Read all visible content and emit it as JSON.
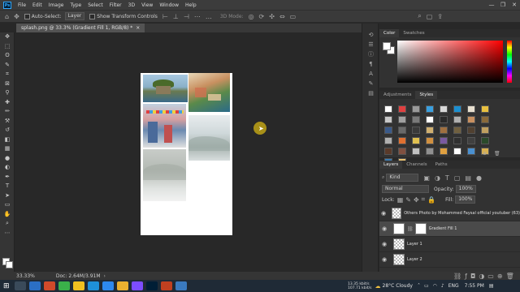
{
  "menubar": {
    "logo": "Ps",
    "items": [
      "File",
      "Edit",
      "Image",
      "Type",
      "Select",
      "Filter",
      "3D",
      "View",
      "Window",
      "Help"
    ],
    "window_controls": [
      "—",
      "❐",
      "✕"
    ]
  },
  "options": {
    "auto_select_label": "Auto-Select:",
    "auto_select_value": "Layer",
    "show_transform_label": "Show Transform Controls",
    "mode_3d": "3D Mode:"
  },
  "document": {
    "tab_title": "splash.png @ 33.3% (Gradient Fill 1, RGB/8) *",
    "tab_close": "×"
  },
  "color_panel": {
    "tabs": [
      "Color",
      "Swatches"
    ],
    "foreground": "#ffffff",
    "background": "#ffffff",
    "hue": "#ff0000"
  },
  "styles_panel": {
    "tabs": [
      "Adjustments",
      "Styles"
    ],
    "swatch_colors": [
      "#ffffff",
      "#e04040",
      "#9a9a9a",
      "#3aa0e0",
      "#d8d8d8",
      "#1c8fd0",
      "#e8e0d0",
      "#e8c040",
      "#c8c8c8",
      "#a0a0a0",
      "#7a7a7a",
      "#ffffff",
      "#2a2a2a",
      "#b0b0b0",
      "#c89060",
      "#8a6a3a",
      "#3a5a8a",
      "#6a6a6a",
      "#3a3a3a",
      "#d0b070",
      "#a07040",
      "#706040",
      "#504030",
      "#c0a060",
      "#b0b0b0",
      "#e07030",
      "#e0c050",
      "#d09040",
      "#7a5aa0",
      "#303030",
      "#404040",
      "#2a4a2a",
      "#5a3a2a",
      "#805040",
      "#c0c0c0",
      "#909090",
      "#e0a040",
      "#ffffff",
      "#4a90d0",
      "#d8b050",
      "#3a7ab0",
      "#e8c070"
    ]
  },
  "layers_panel": {
    "tabs": [
      "Layers",
      "Channels",
      "Paths"
    ],
    "filter_kind": "Kind",
    "blend_mode": "Normal",
    "opacity_label": "Opacity:",
    "opacity_value": "100%",
    "lock_label": "Lock:",
    "fill_label": "Fill:",
    "fill_value": "100%",
    "layers": [
      {
        "name": "Others Photo by Mohammed Faysal official youtuber (63)",
        "selected": false
      },
      {
        "name": "Gradient Fill 1",
        "selected": true
      },
      {
        "name": "Layer 1",
        "selected": false
      },
      {
        "name": "Layer 2",
        "selected": false
      }
    ]
  },
  "statusbar": {
    "zoom": "33.33%",
    "doc_info": "Doc: 2.64M/3.91M"
  },
  "taskbar": {
    "net_up": "13.35 kbit/s",
    "net_down": "107.71 kbit/s",
    "weather": "28°C Cloudy",
    "lang": "ENG",
    "time": "7:55 PM",
    "icon_colors": [
      "#3a4a5a",
      "#2b6fc4",
      "#d04a2a",
      "#3ab04a",
      "#f0c020",
      "#1e90d8",
      "#2d89ef",
      "#e8b030",
      "#7c4dff",
      "#001e36",
      "#c04020",
      "#3a7ac0"
    ]
  }
}
